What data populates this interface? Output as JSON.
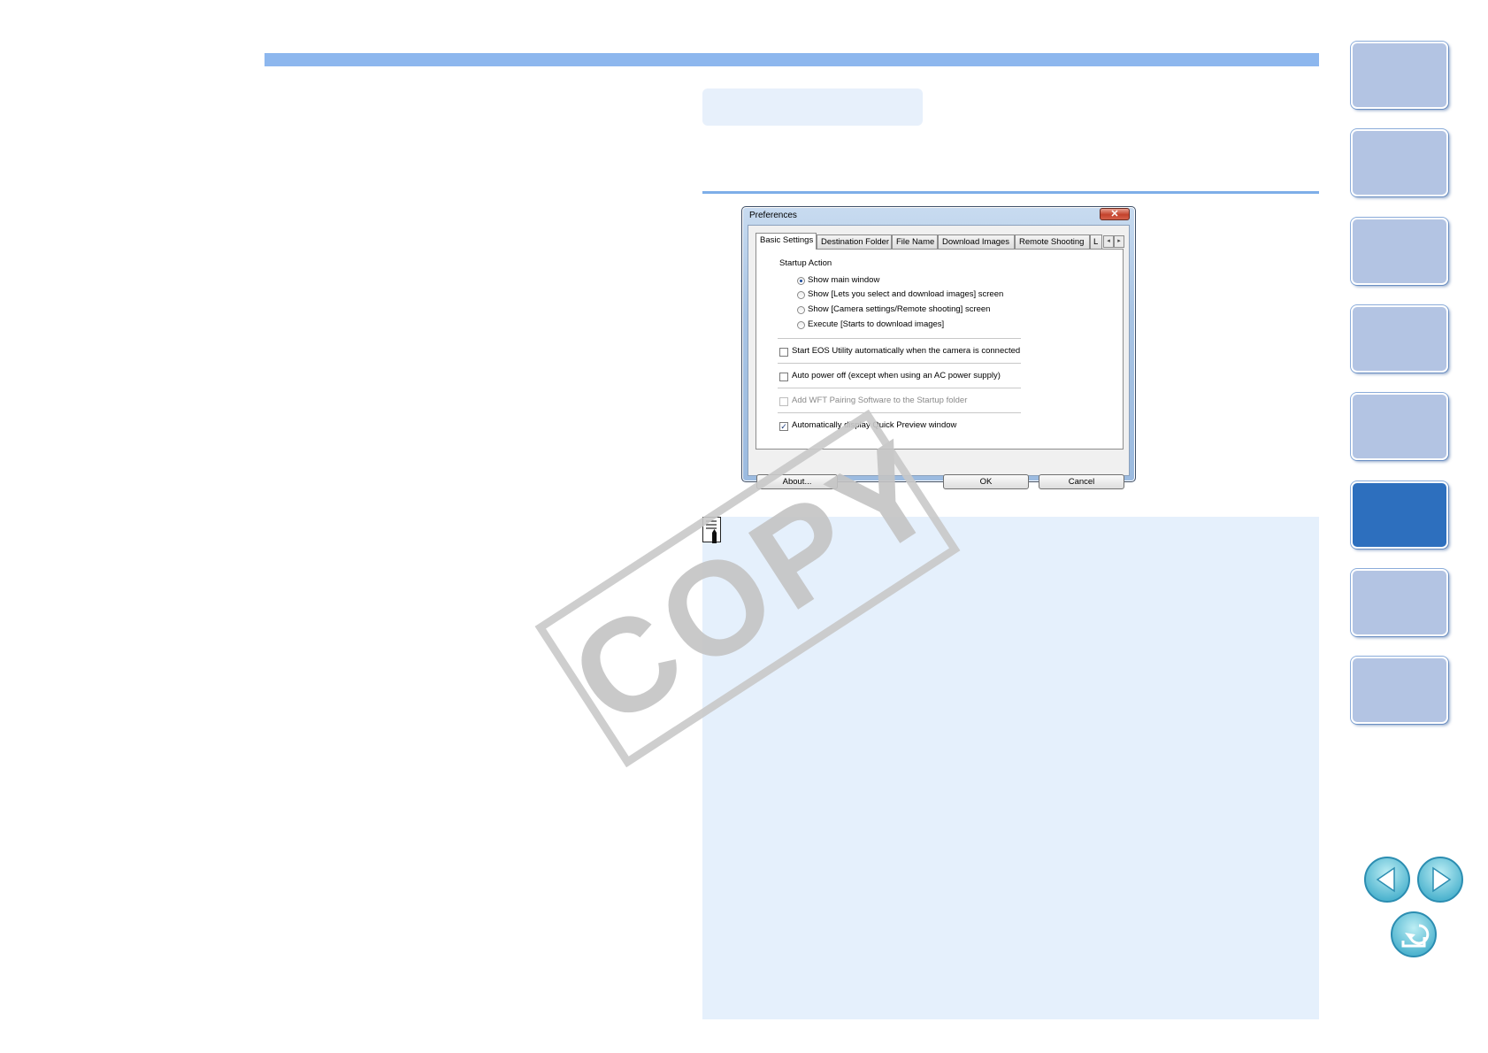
{
  "dialog": {
    "title": "Preferences",
    "close_glyph": "✕",
    "tabs": [
      "Basic Settings",
      "Destination Folder",
      "File Name",
      "Download Images",
      "Remote Shooting",
      "L"
    ],
    "active_tab": "Basic Settings",
    "scroll_left": "◂",
    "scroll_right": "▸",
    "startup_group_label": "Startup Action",
    "startup_options": [
      {
        "label": "Show main window",
        "checked": true
      },
      {
        "label": "Show [Lets you select and download images] screen",
        "checked": false
      },
      {
        "label": "Show [Camera settings/Remote shooting] screen",
        "checked": false
      },
      {
        "label": "Execute [Starts to download images]",
        "checked": false
      }
    ],
    "checkboxes": [
      {
        "label": "Start EOS Utility automatically when the camera is connected",
        "checked": false,
        "enabled": true
      },
      {
        "label": "Auto power off (except when using an AC power supply)",
        "checked": false,
        "enabled": true
      },
      {
        "label": "Add WFT Pairing Software to the Startup folder",
        "checked": false,
        "enabled": false
      },
      {
        "label": "Automatically display Quick Preview window",
        "checked": true,
        "enabled": true
      }
    ],
    "check_glyph": "✓",
    "buttons": {
      "about": "About...",
      "ok": "OK",
      "cancel": "Cancel"
    }
  },
  "watermark": "COPY",
  "side_nav": {
    "tab_count": 8,
    "active_index": 5
  },
  "nav_icons": {
    "prev": "previous-page-icon",
    "next": "next-page-icon",
    "back": "return-icon"
  },
  "colors": {
    "accent": "#8db7ee",
    "panel": "#e5f0fc",
    "active_tab": "#2d6fbe",
    "inactive_tab": "#b3c4e3"
  }
}
